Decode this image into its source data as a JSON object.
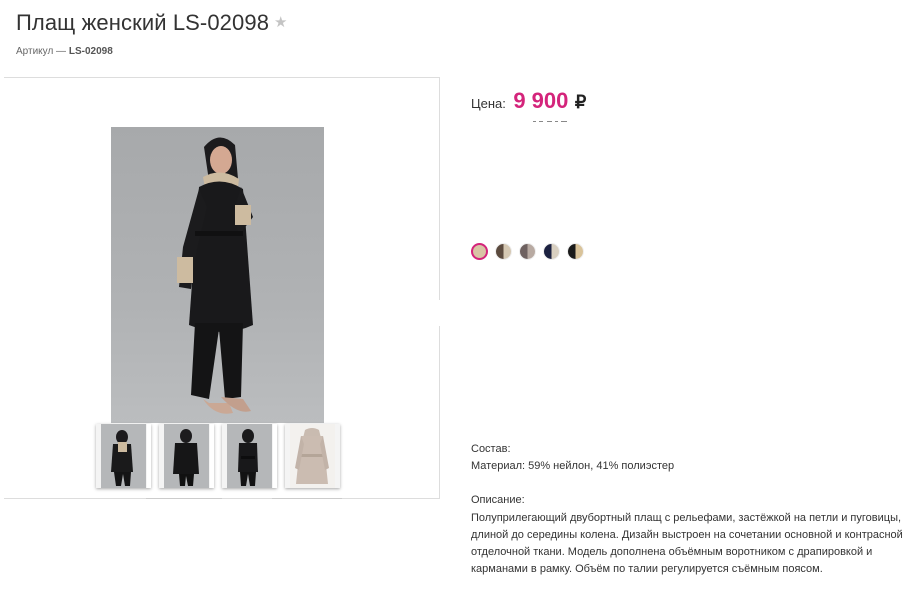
{
  "product": {
    "title": "Плащ женский LS-02098",
    "favorite_icon": "★",
    "sku_label": "Артикул —",
    "sku_value": "LS-02098"
  },
  "price": {
    "label": "Цена:",
    "value": "9 900",
    "currency": "₽",
    "accent_color": "#d4247b"
  },
  "gallery": {
    "thumbnails": [
      {
        "name": "thumb-1",
        "view": "front-light"
      },
      {
        "name": "thumb-2",
        "view": "front-dark"
      },
      {
        "name": "thumb-3",
        "view": "back"
      },
      {
        "name": "thumb-4",
        "view": "beige-coat"
      }
    ]
  },
  "colors": [
    {
      "name": "beige",
      "colors": [
        "#d9c4a5",
        "#d9c4a5"
      ],
      "selected": true
    },
    {
      "name": "brown-beige",
      "colors": [
        "#5b4a3e",
        "#d5c8b3"
      ]
    },
    {
      "name": "grey-brown",
      "colors": [
        "#6e6160",
        "#b8aaa2"
      ]
    },
    {
      "name": "navy-beige",
      "colors": [
        "#1b2140",
        "#d8cfc0"
      ]
    },
    {
      "name": "black-beige",
      "colors": [
        "#1a1a1a",
        "#d9c39a"
      ]
    }
  ],
  "composition": {
    "heading": "Состав:",
    "text": "Материал: 59% нейлон, 41% полиэстер"
  },
  "description": {
    "heading": "Описание:",
    "text": "Полуприлегающий двубортный плащ с рельефами, застёжкой на петли и пуговицы, длиной до середины колена. Дизайн выстроен на сочетании основной и контрасной отделочной ткани. Модель дополнена объёмным воротником с драпировкой и карманами в рамку. Объём по талии регулируется съёмным поясом."
  }
}
